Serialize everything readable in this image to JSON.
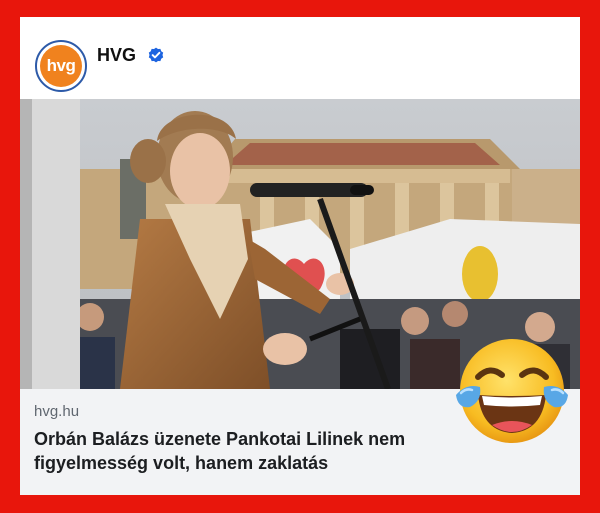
{
  "post": {
    "avatar_text": "hvg",
    "page_name": "HVG",
    "verified": true
  },
  "link": {
    "domain": "hvg.hu",
    "headline_line1": "Orbán Balázs üzenete Pankotai Lilinek nem",
    "headline_line2": "figyelmesség volt, hanem zaklatás"
  },
  "icons": {
    "verified": "verified-badge-icon",
    "emoji": "face-with-tears-of-joy-icon"
  },
  "colors": {
    "border": "#e8160c",
    "brand_orange": "#f0821e",
    "brand_blue": "#2d5aa8",
    "verified_blue": "#1d64e0"
  }
}
